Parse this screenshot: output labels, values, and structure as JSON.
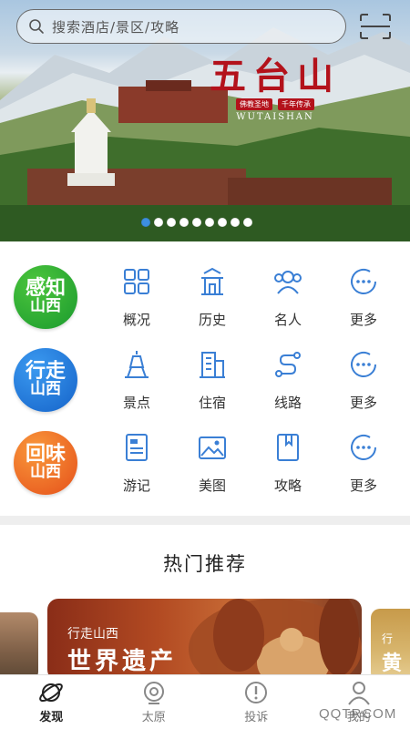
{
  "search": {
    "placeholder": "搜索酒店/景区/攻略"
  },
  "banner": {
    "title": "五台山",
    "tag_left": "佛教圣地",
    "tag_right": "千年传承",
    "pinyin": "WUTAISHAN",
    "slide_count": 9,
    "active_slide": 0
  },
  "categories": [
    {
      "badge": {
        "line1": "感知",
        "line2": "山西",
        "color": "#1a9a2e",
        "color2": "#4cc53c"
      },
      "items": [
        {
          "label": "概况",
          "icon": "grid-icon"
        },
        {
          "label": "历史",
          "icon": "temple-icon"
        },
        {
          "label": "名人",
          "icon": "people-icon"
        },
        {
          "label": "更多",
          "icon": "more-icon"
        }
      ]
    },
    {
      "badge": {
        "line1": "行走",
        "line2": "山西",
        "color": "#1563c9",
        "color2": "#3b9af0"
      },
      "items": [
        {
          "label": "景点",
          "icon": "tower-icon"
        },
        {
          "label": "住宿",
          "icon": "building-icon"
        },
        {
          "label": "线路",
          "icon": "route-icon"
        },
        {
          "label": "更多",
          "icon": "more-icon"
        }
      ]
    },
    {
      "badge": {
        "line1": "回味",
        "line2": "山西",
        "color": "#e5501a",
        "color2": "#f9983b"
      },
      "items": [
        {
          "label": "游记",
          "icon": "travelog-icon"
        },
        {
          "label": "美图",
          "icon": "photo-icon"
        },
        {
          "label": "攻略",
          "icon": "bookmark-icon"
        },
        {
          "label": "更多",
          "icon": "more-icon"
        }
      ]
    }
  ],
  "hot": {
    "title": "热门推荐",
    "card": {
      "kicker": "行走山西",
      "heading": "世界遗产"
    },
    "next_card": {
      "kicker": "行",
      "heading": "黄"
    }
  },
  "tabs": [
    {
      "label": "发现",
      "icon": "planet-icon",
      "active": true
    },
    {
      "label": "太原",
      "icon": "location-icon",
      "active": false
    },
    {
      "label": "投诉",
      "icon": "alert-icon",
      "active": false
    },
    {
      "label": "我的",
      "icon": "user-icon",
      "active": false
    }
  ],
  "watermark": "QQTRCOM",
  "colors": {
    "accent": "#3d8fe0",
    "icon_blue": "#3a7fd5",
    "brand_red": "#b3121b"
  }
}
